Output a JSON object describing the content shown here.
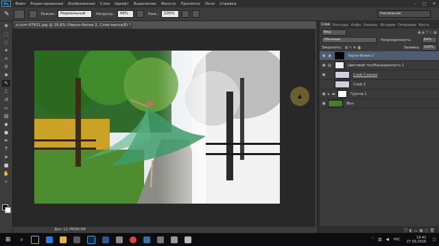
{
  "menu": {
    "logo": "Ps",
    "items": [
      "Файл",
      "Редактирование",
      "Изображение",
      "Слои",
      "Шрифт",
      "Выделение",
      "Фильтр",
      "Просмотр",
      "Окно",
      "Справка"
    ]
  },
  "options": {
    "mode_label": "Режим:",
    "mode_value": "Нормальный",
    "opacity_label": "Непрозр.:",
    "opacity_value": "49%",
    "flow_label": "Наж.:",
    "flow_value": "100%",
    "workspace": "Рисование"
  },
  "document": {
    "tab": "o.com-97621.jpg @ 29,8% (Черно-белое 2, Слой-маска/8) *",
    "status": "Док: 11,7М/56,9М"
  },
  "layers_panel": {
    "tabs": [
      "Слои",
      "Контуры",
      "Инфо",
      "Каналы",
      "История",
      "Операции",
      "Кисть"
    ],
    "filter": "Вид",
    "blend": "Обычные",
    "opacity_label": "Непрозрачность:",
    "opacity": "64%",
    "lock_label": "Закрепить:",
    "fill_label": "Заливка:",
    "fill": "100%",
    "layers": [
      {
        "name": "Черно-белое 2",
        "selected": true
      },
      {
        "name": "Цветовой тон/Насыщенность 1",
        "selected": false
      },
      {
        "name": "Слой 3 копия",
        "selected": false
      },
      {
        "name": "Слой 3",
        "selected": false
      },
      {
        "name": "Группа 1",
        "selected": false
      },
      {
        "name": "Фон",
        "selected": false
      }
    ]
  },
  "taskbar": {
    "lang": "РУС",
    "time": "19:42",
    "date": "27.09.2016"
  },
  "colors": {
    "accent": "#31a8ff",
    "panel": "#3a3a3a",
    "selected": "#4d5d6f"
  }
}
